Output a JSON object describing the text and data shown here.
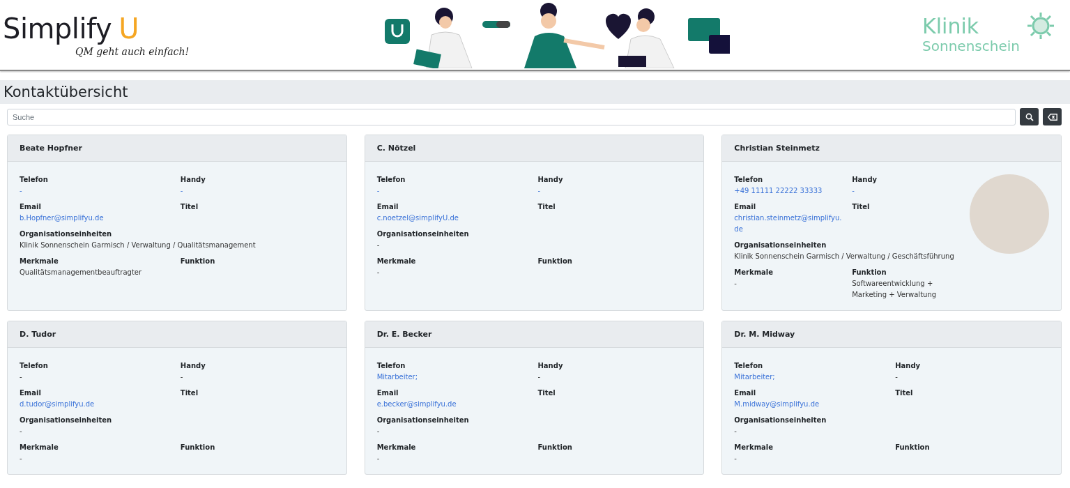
{
  "header": {
    "logo": {
      "name": "Simplify",
      "mark": "U",
      "tagline": "QM geht auch einfach!"
    },
    "clinic": {
      "line_1": "Klinik",
      "line_2": "Sonnenschein"
    }
  },
  "page_title": "Kontaktübersicht",
  "search": {
    "placeholder": "Suche"
  },
  "contacts": [
    {
      "name": "Beate Hopfner",
      "photo": false,
      "fields": [
        {
          "label": "Telefon",
          "value": "-",
          "kind": "link"
        },
        {
          "label": "Handy",
          "value": "-",
          "kind": "link"
        },
        {
          "label": "Email",
          "value": "b.Hopfner@simplifyu.de",
          "kind": "link"
        },
        {
          "label": "Titel"
        },
        {
          "label": "Organisationseinheiten",
          "value": "Klinik Sonnenschein Garmisch / Verwaltung / Qualitätsmanagement",
          "kind": "text"
        },
        {
          "label": "Merkmale",
          "value": "Qualitätsmanagementbeauftragter",
          "kind": "text"
        },
        {
          "label": "Funktion"
        }
      ]
    },
    {
      "name": "C. Nötzel",
      "photo": false,
      "fields": [
        {
          "label": "Telefon",
          "value": "-",
          "kind": "link"
        },
        {
          "label": "Handy",
          "value": "-",
          "kind": "link"
        },
        {
          "label": "Email",
          "value": "c.noetzel@simplifyU.de",
          "kind": "link"
        },
        {
          "label": "Titel"
        },
        {
          "label": "Organisationseinheiten",
          "value": "-",
          "kind": "text"
        },
        {
          "label": "Merkmale",
          "value": "-",
          "kind": "text"
        },
        {
          "label": "Funktion"
        }
      ]
    },
    {
      "name": "Christian Steinmetz",
      "photo": true,
      "fields": [
        {
          "label": "Telefon",
          "value": "+49 11111 22222 33333",
          "kind": "link"
        },
        {
          "label": "Handy",
          "value": "-",
          "kind": "link"
        },
        {
          "label": "Email",
          "value": "christian.steinmetz@simplifyu.de",
          "kind": "link"
        },
        {
          "label": "Titel"
        },
        {
          "label": "Organisationseinheiten",
          "value": "Klinik Sonnenschein Garmisch / Verwaltung / Geschäftsführung",
          "kind": "text"
        },
        {
          "label": "Merkmale",
          "value": "-",
          "kind": "text"
        },
        {
          "label": "Funktion",
          "value": "Softwareentwicklung + Marketing + Verwaltung",
          "kind": "text"
        }
      ]
    },
    {
      "name": "D. Tudor",
      "photo": false,
      "fields": [
        {
          "label": "Telefon",
          "value": "-",
          "kind": "text"
        },
        {
          "label": "Handy",
          "value": "-",
          "kind": "text"
        },
        {
          "label": "Email",
          "value": "d.tudor@simplifyu.de",
          "kind": "link"
        },
        {
          "label": "Titel"
        },
        {
          "label": "Organisationseinheiten",
          "value": "-",
          "kind": "text"
        },
        {
          "label": "Merkmale",
          "value": "-",
          "kind": "text"
        },
        {
          "label": "Funktion"
        }
      ]
    },
    {
      "name": "Dr. E. Becker",
      "photo": false,
      "fields": [
        {
          "label": "Telefon",
          "value": "Mitarbeiter;",
          "kind": "link"
        },
        {
          "label": "Handy",
          "value": "-",
          "kind": "text"
        },
        {
          "label": "Email",
          "value": "e.becker@simplifyu.de",
          "kind": "link"
        },
        {
          "label": "Titel"
        },
        {
          "label": "Organisationseinheiten",
          "value": "-",
          "kind": "text"
        },
        {
          "label": "Merkmale",
          "value": "-",
          "kind": "text"
        },
        {
          "label": "Funktion"
        }
      ]
    },
    {
      "name": "Dr. M. Midway",
      "photo": false,
      "fields": [
        {
          "label": "Telefon",
          "value": "Mitarbeiter;",
          "kind": "link"
        },
        {
          "label": "Handy",
          "value": "-",
          "kind": "text"
        },
        {
          "label": "Email",
          "value": "M.midway@simplifyu.de",
          "kind": "link"
        },
        {
          "label": "Titel"
        },
        {
          "label": "Organisationseinheiten",
          "value": "-",
          "kind": "text"
        },
        {
          "label": "Merkmale",
          "value": "-",
          "kind": "text"
        },
        {
          "label": "Funktion"
        }
      ]
    }
  ]
}
